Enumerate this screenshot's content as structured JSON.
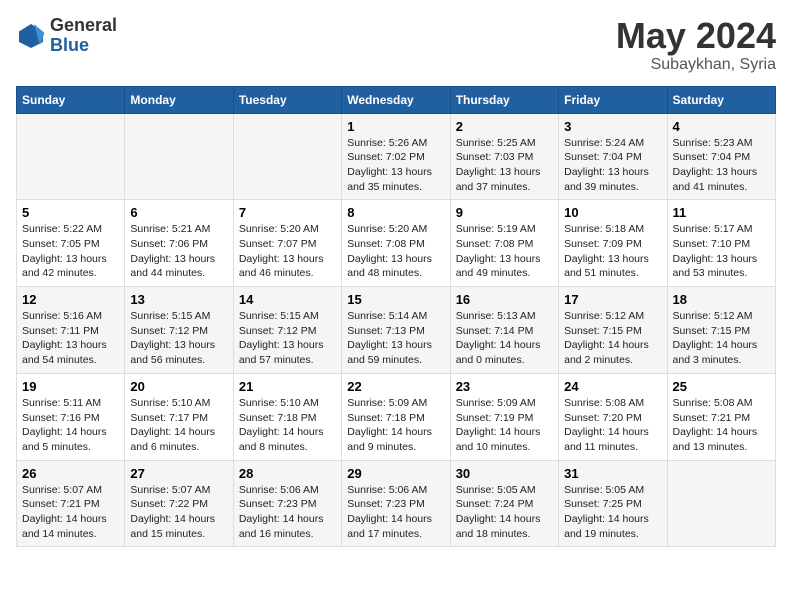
{
  "logo": {
    "general": "General",
    "blue": "Blue"
  },
  "title": {
    "month": "May 2024",
    "location": "Subaykhan, Syria"
  },
  "weekdays": [
    "Sunday",
    "Monday",
    "Tuesday",
    "Wednesday",
    "Thursday",
    "Friday",
    "Saturday"
  ],
  "weeks": [
    [
      {
        "day": "",
        "text": ""
      },
      {
        "day": "",
        "text": ""
      },
      {
        "day": "",
        "text": ""
      },
      {
        "day": "1",
        "text": "Sunrise: 5:26 AM\nSunset: 7:02 PM\nDaylight: 13 hours\nand 35 minutes."
      },
      {
        "day": "2",
        "text": "Sunrise: 5:25 AM\nSunset: 7:03 PM\nDaylight: 13 hours\nand 37 minutes."
      },
      {
        "day": "3",
        "text": "Sunrise: 5:24 AM\nSunset: 7:04 PM\nDaylight: 13 hours\nand 39 minutes."
      },
      {
        "day": "4",
        "text": "Sunrise: 5:23 AM\nSunset: 7:04 PM\nDaylight: 13 hours\nand 41 minutes."
      }
    ],
    [
      {
        "day": "5",
        "text": "Sunrise: 5:22 AM\nSunset: 7:05 PM\nDaylight: 13 hours\nand 42 minutes."
      },
      {
        "day": "6",
        "text": "Sunrise: 5:21 AM\nSunset: 7:06 PM\nDaylight: 13 hours\nand 44 minutes."
      },
      {
        "day": "7",
        "text": "Sunrise: 5:20 AM\nSunset: 7:07 PM\nDaylight: 13 hours\nand 46 minutes."
      },
      {
        "day": "8",
        "text": "Sunrise: 5:20 AM\nSunset: 7:08 PM\nDaylight: 13 hours\nand 48 minutes."
      },
      {
        "day": "9",
        "text": "Sunrise: 5:19 AM\nSunset: 7:08 PM\nDaylight: 13 hours\nand 49 minutes."
      },
      {
        "day": "10",
        "text": "Sunrise: 5:18 AM\nSunset: 7:09 PM\nDaylight: 13 hours\nand 51 minutes."
      },
      {
        "day": "11",
        "text": "Sunrise: 5:17 AM\nSunset: 7:10 PM\nDaylight: 13 hours\nand 53 minutes."
      }
    ],
    [
      {
        "day": "12",
        "text": "Sunrise: 5:16 AM\nSunset: 7:11 PM\nDaylight: 13 hours\nand 54 minutes."
      },
      {
        "day": "13",
        "text": "Sunrise: 5:15 AM\nSunset: 7:12 PM\nDaylight: 13 hours\nand 56 minutes."
      },
      {
        "day": "14",
        "text": "Sunrise: 5:15 AM\nSunset: 7:12 PM\nDaylight: 13 hours\nand 57 minutes."
      },
      {
        "day": "15",
        "text": "Sunrise: 5:14 AM\nSunset: 7:13 PM\nDaylight: 13 hours\nand 59 minutes."
      },
      {
        "day": "16",
        "text": "Sunrise: 5:13 AM\nSunset: 7:14 PM\nDaylight: 14 hours\nand 0 minutes."
      },
      {
        "day": "17",
        "text": "Sunrise: 5:12 AM\nSunset: 7:15 PM\nDaylight: 14 hours\nand 2 minutes."
      },
      {
        "day": "18",
        "text": "Sunrise: 5:12 AM\nSunset: 7:15 PM\nDaylight: 14 hours\nand 3 minutes."
      }
    ],
    [
      {
        "day": "19",
        "text": "Sunrise: 5:11 AM\nSunset: 7:16 PM\nDaylight: 14 hours\nand 5 minutes."
      },
      {
        "day": "20",
        "text": "Sunrise: 5:10 AM\nSunset: 7:17 PM\nDaylight: 14 hours\nand 6 minutes."
      },
      {
        "day": "21",
        "text": "Sunrise: 5:10 AM\nSunset: 7:18 PM\nDaylight: 14 hours\nand 8 minutes."
      },
      {
        "day": "22",
        "text": "Sunrise: 5:09 AM\nSunset: 7:18 PM\nDaylight: 14 hours\nand 9 minutes."
      },
      {
        "day": "23",
        "text": "Sunrise: 5:09 AM\nSunset: 7:19 PM\nDaylight: 14 hours\nand 10 minutes."
      },
      {
        "day": "24",
        "text": "Sunrise: 5:08 AM\nSunset: 7:20 PM\nDaylight: 14 hours\nand 11 minutes."
      },
      {
        "day": "25",
        "text": "Sunrise: 5:08 AM\nSunset: 7:21 PM\nDaylight: 14 hours\nand 13 minutes."
      }
    ],
    [
      {
        "day": "26",
        "text": "Sunrise: 5:07 AM\nSunset: 7:21 PM\nDaylight: 14 hours\nand 14 minutes."
      },
      {
        "day": "27",
        "text": "Sunrise: 5:07 AM\nSunset: 7:22 PM\nDaylight: 14 hours\nand 15 minutes."
      },
      {
        "day": "28",
        "text": "Sunrise: 5:06 AM\nSunset: 7:23 PM\nDaylight: 14 hours\nand 16 minutes."
      },
      {
        "day": "29",
        "text": "Sunrise: 5:06 AM\nSunset: 7:23 PM\nDaylight: 14 hours\nand 17 minutes."
      },
      {
        "day": "30",
        "text": "Sunrise: 5:05 AM\nSunset: 7:24 PM\nDaylight: 14 hours\nand 18 minutes."
      },
      {
        "day": "31",
        "text": "Sunrise: 5:05 AM\nSunset: 7:25 PM\nDaylight: 14 hours\nand 19 minutes."
      },
      {
        "day": "",
        "text": ""
      }
    ]
  ]
}
